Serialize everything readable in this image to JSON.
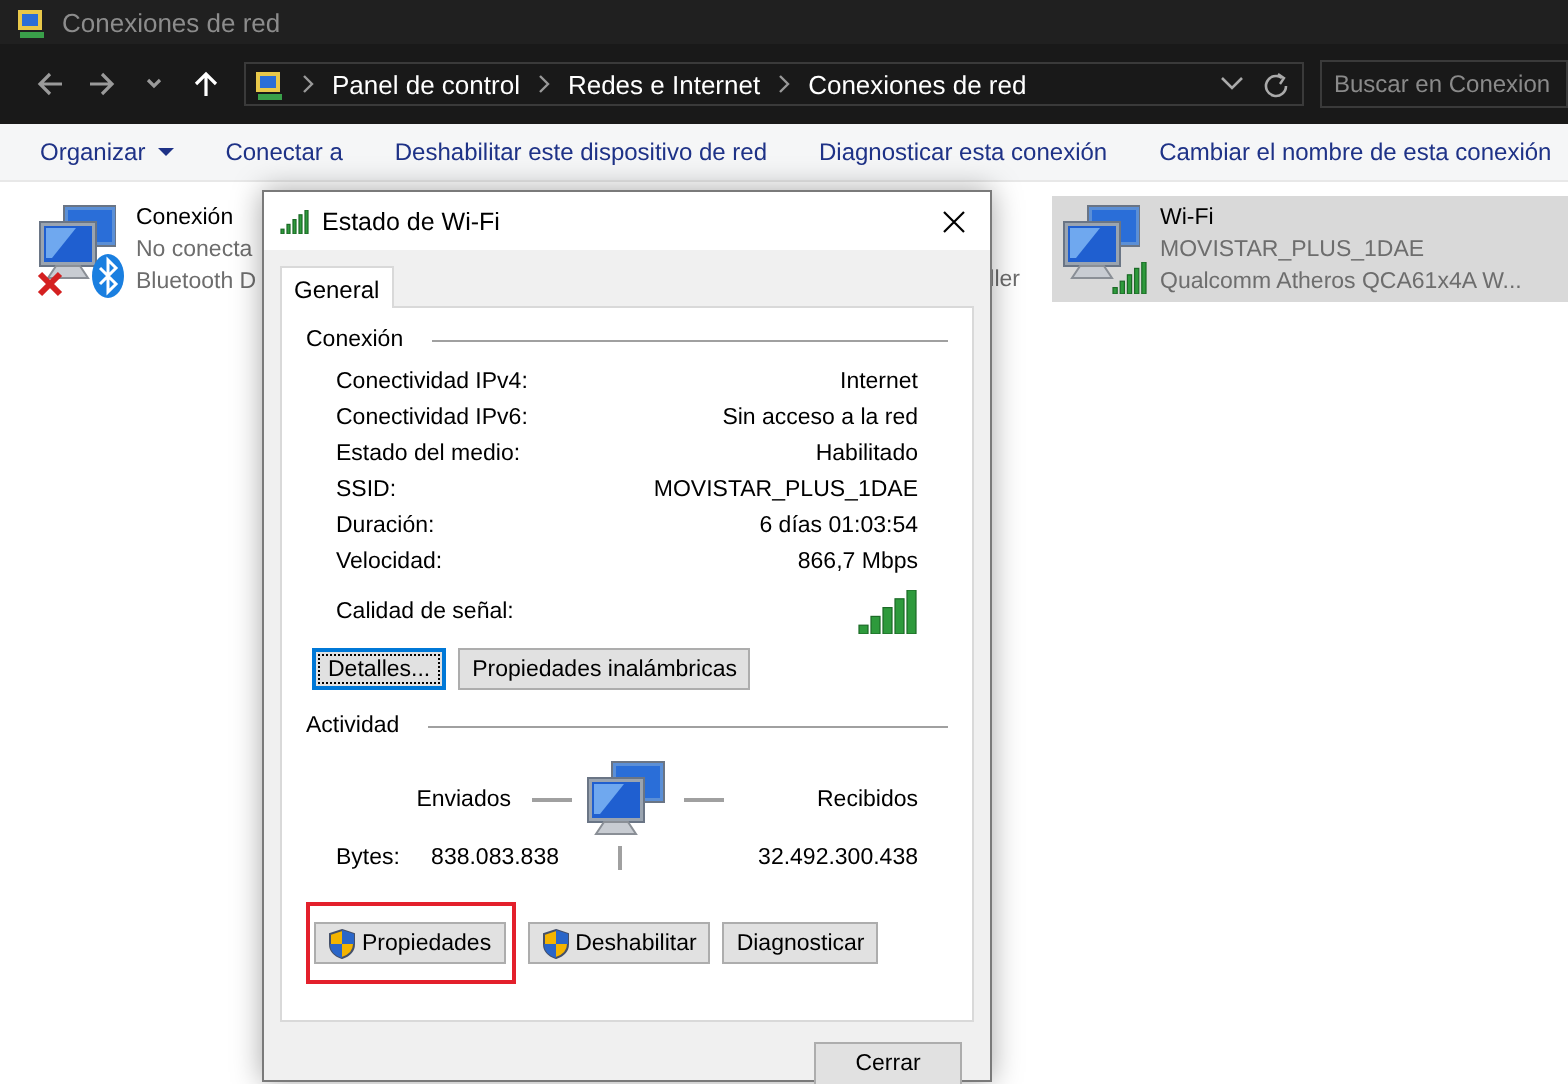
{
  "window": {
    "title": "Conexiones de red"
  },
  "address_bar": {
    "path": [
      "Panel de control",
      "Redes e Internet",
      "Conexiones de red"
    ]
  },
  "search": {
    "placeholder": "Buscar en Conexion"
  },
  "toolbar": [
    {
      "label": "Organizar",
      "kind": "menu"
    },
    {
      "label": "Conectar a",
      "kind": "plain"
    },
    {
      "label": "Deshabilitar este dispositivo de red",
      "kind": "plain"
    },
    {
      "label": "Diagnosticar esta conexión",
      "kind": "plain"
    },
    {
      "label": "Cambiar el nombre de esta conexión",
      "kind": "plain"
    }
  ],
  "connections": [
    {
      "kind": "bluetooth",
      "name": "Conexión",
      "status": "No conecta",
      "device": "Bluetooth D",
      "selected": false
    },
    {
      "kind": "covered",
      "device": "ller",
      "selected": false
    },
    {
      "kind": "wifi",
      "name": "Wi-Fi",
      "status": "MOVISTAR_PLUS_1DAE",
      "device": "Qualcomm Atheros QCA61x4A W...",
      "selected": true
    }
  ],
  "dialog": {
    "title": "Estado de Wi-Fi",
    "tabs": [
      {
        "label": "General",
        "selected": true
      }
    ],
    "connection": {
      "heading": "Conexión",
      "rows": [
        {
          "label": "Conectividad IPv4:",
          "value": "Internet"
        },
        {
          "label": "Conectividad IPv6:",
          "value": "Sin acceso a la red"
        },
        {
          "label": "Estado del medio:",
          "value": "Habilitado"
        },
        {
          "label": "SSID:",
          "value": "MOVISTAR_PLUS_1DAE"
        },
        {
          "label": "Duración:",
          "value": "6 días 01:03:54"
        },
        {
          "label": "Velocidad:",
          "value": "866,7 Mbps"
        }
      ],
      "signal_label": "Calidad de señal:",
      "buttons": [
        {
          "label": "Detalles...",
          "focused": true
        },
        {
          "label": "Propiedades inalámbricas",
          "focused": false
        }
      ]
    },
    "activity": {
      "heading": "Actividad",
      "sent_label": "Enviados",
      "received_label": "Recibidos",
      "bytes_label": "Bytes:",
      "sent": "838.083.838",
      "received": "32.492.300.438"
    },
    "buttons": [
      {
        "label": "Propiedades",
        "shield": true,
        "highlighted": true
      },
      {
        "label": "Deshabilitar",
        "shield": true,
        "highlighted": false
      },
      {
        "label": "Diagnosticar",
        "shield": false,
        "highlighted": false
      }
    ],
    "close_button": "Cerrar"
  }
}
